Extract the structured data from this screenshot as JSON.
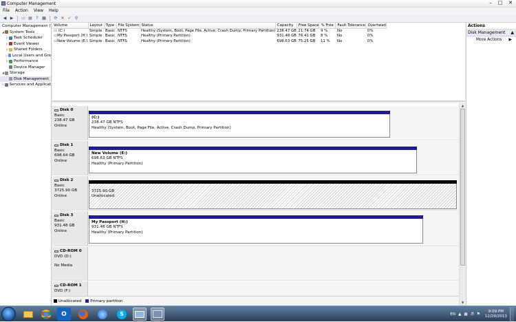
{
  "window": {
    "title": "Computer Management"
  },
  "menu": [
    "File",
    "Action",
    "View",
    "Help"
  ],
  "tree": {
    "root": "Computer Management (Local",
    "system_tools": "System Tools",
    "task_scheduler": "Task Scheduler",
    "event_viewer": "Event Viewer",
    "shared_folders": "Shared Folders",
    "local_users": "Local Users and Gro",
    "performance": "Performance",
    "device_manager": "Device Manager",
    "storage": "Storage",
    "disk_management": "Disk Management",
    "services": "Services and Applicat"
  },
  "actions": {
    "header": "Actions",
    "section": "Disk Management",
    "more": "More Actions"
  },
  "volume_table": {
    "headers": [
      "Volume",
      "Layout",
      "Type",
      "File System",
      "Status",
      "Capacity",
      "Free Space",
      "% Free",
      "Fault Tolerance",
      "Overhead"
    ],
    "rows": [
      [
        "(C:)",
        "Simple",
        "Basic",
        "NTFS",
        "Healthy (System, Boot, Page File, Active, Crash Dump, Primary Partition)",
        "238.47 GB",
        "21.74 GB",
        "9 %",
        "No",
        "0%"
      ],
      [
        "My Passport (H:)",
        "Simple",
        "Basic",
        "NTFS",
        "Healthy (Primary Partition)",
        "931.48 GB",
        "76.41 GB",
        "8 %",
        "No",
        "0%"
      ],
      [
        "New Volume (E:)",
        "Simple",
        "Basic",
        "NTFS",
        "Healthy (Primary Partition)",
        "698.63 GB",
        "75.25 GB",
        "11 %",
        "No",
        "0%"
      ]
    ]
  },
  "disks": [
    {
      "name": "Disk 0",
      "type": "Basic",
      "size": "238.47 GB",
      "state": "Online",
      "part_name": "(C:)",
      "part_size": "238.47 GB NTFS",
      "part_status": "Healthy (System, Boot, Page File, Active, Crash Dump, Primary Partition)"
    },
    {
      "name": "Disk 1",
      "type": "Basic",
      "size": "698.64 GB",
      "state": "Online",
      "part_name": "New Volume  (E:)",
      "part_size": "698.63 GB NTFS",
      "part_status": "Healthy (Primary Partition)"
    },
    {
      "name": "Disk 2",
      "type": "Basic",
      "size": "3725.90 GB",
      "state": "Online",
      "part_name": "",
      "part_size": "3725.90 GB",
      "part_status": "Unallocated"
    },
    {
      "name": "Disk 3",
      "type": "Basic",
      "size": "931.48 GB",
      "state": "Online",
      "part_name": "My Passport  (H:)",
      "part_size": "931.48 GB NTFS",
      "part_status": "Healthy (Primary Partition)"
    }
  ],
  "cdroms": [
    {
      "name": "CD-ROM 0",
      "drive": "DVD (D:)",
      "media": "No Media"
    },
    {
      "name": "CD-ROM 1",
      "drive": "DVD (F:)"
    }
  ],
  "legend": {
    "unallocated": "Unallocated",
    "primary": "Primary partition"
  },
  "colors": {
    "primary_bar": "#1d1d8f",
    "unallocated_bar": "#000000"
  },
  "taskbar": {
    "lang": "EN",
    "time": "9:09 PM",
    "date": "12/29/2013"
  }
}
